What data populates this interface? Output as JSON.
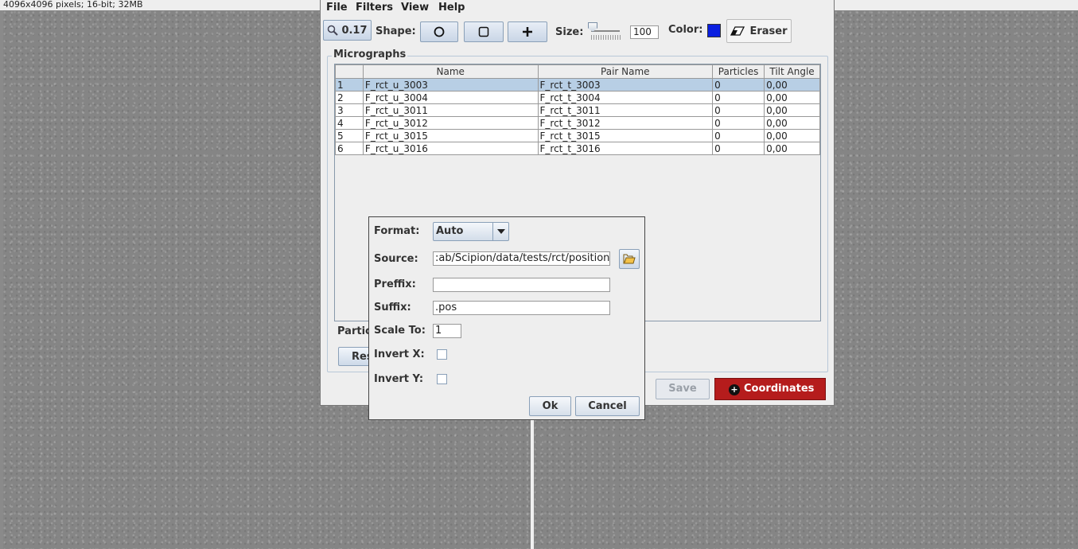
{
  "background": {
    "info": "4096x4096 pixels; 16-bit; 32MB"
  },
  "menu": [
    "File",
    "Filters",
    "View",
    "Help"
  ],
  "toolbar": {
    "zoom": "0.17",
    "shape_label": "Shape:",
    "size_label": "Size:",
    "size_value": "100",
    "color_label": "Color:",
    "color_value": "#0a1fe0",
    "eraser_label": "Eraser"
  },
  "micrographs": {
    "title": "Micrographs",
    "columns": [
      "",
      "Name",
      "Pair Name",
      "Particles",
      "Tilt Angle"
    ],
    "rows": [
      [
        "1",
        "F_rct_u_3003",
        "F_rct_t_3003",
        "0",
        "0,00"
      ],
      [
        "2",
        "F_rct_u_3004",
        "F_rct_t_3004",
        "0",
        "0,00"
      ],
      [
        "3",
        "F_rct_u_3011",
        "F_rct_t_3011",
        "0",
        "0,00"
      ],
      [
        "4",
        "F_rct_u_3012",
        "F_rct_t_3012",
        "0",
        "0,00"
      ],
      [
        "5",
        "F_rct_u_3015",
        "F_rct_t_3015",
        "0",
        "0,00"
      ],
      [
        "6",
        "F_rct_u_3016",
        "F_rct_t_3016",
        "0",
        "0,00"
      ]
    ],
    "selected_row": 0
  },
  "bottom": {
    "particles_label": "Partic",
    "reset_label": "Res",
    "save_label": "Save",
    "coordinates_label": "Coordinates"
  },
  "dialog": {
    "format_label": "Format:",
    "format_value": "Auto",
    "source_label": "Source:",
    "source_value": ":ab/Scipion/data/tests/rct/positions",
    "prefix_label": "Preffix:",
    "prefix_value": "",
    "suffix_label": "Suffix:",
    "suffix_value": ".pos",
    "scale_label": "Scale To:",
    "scale_value": "1",
    "invert_x_label": "Invert X:",
    "invert_y_label": "Invert Y:",
    "invert_x": false,
    "invert_y": false,
    "ok_label": "Ok",
    "cancel_label": "Cancel"
  },
  "icons": [
    "magnifier-icon",
    "circle-shape-icon",
    "square-shape-icon",
    "cross-shape-icon",
    "eraser-icon",
    "folder-icon",
    "add-icon",
    "dropdown-arrow-icon"
  ]
}
